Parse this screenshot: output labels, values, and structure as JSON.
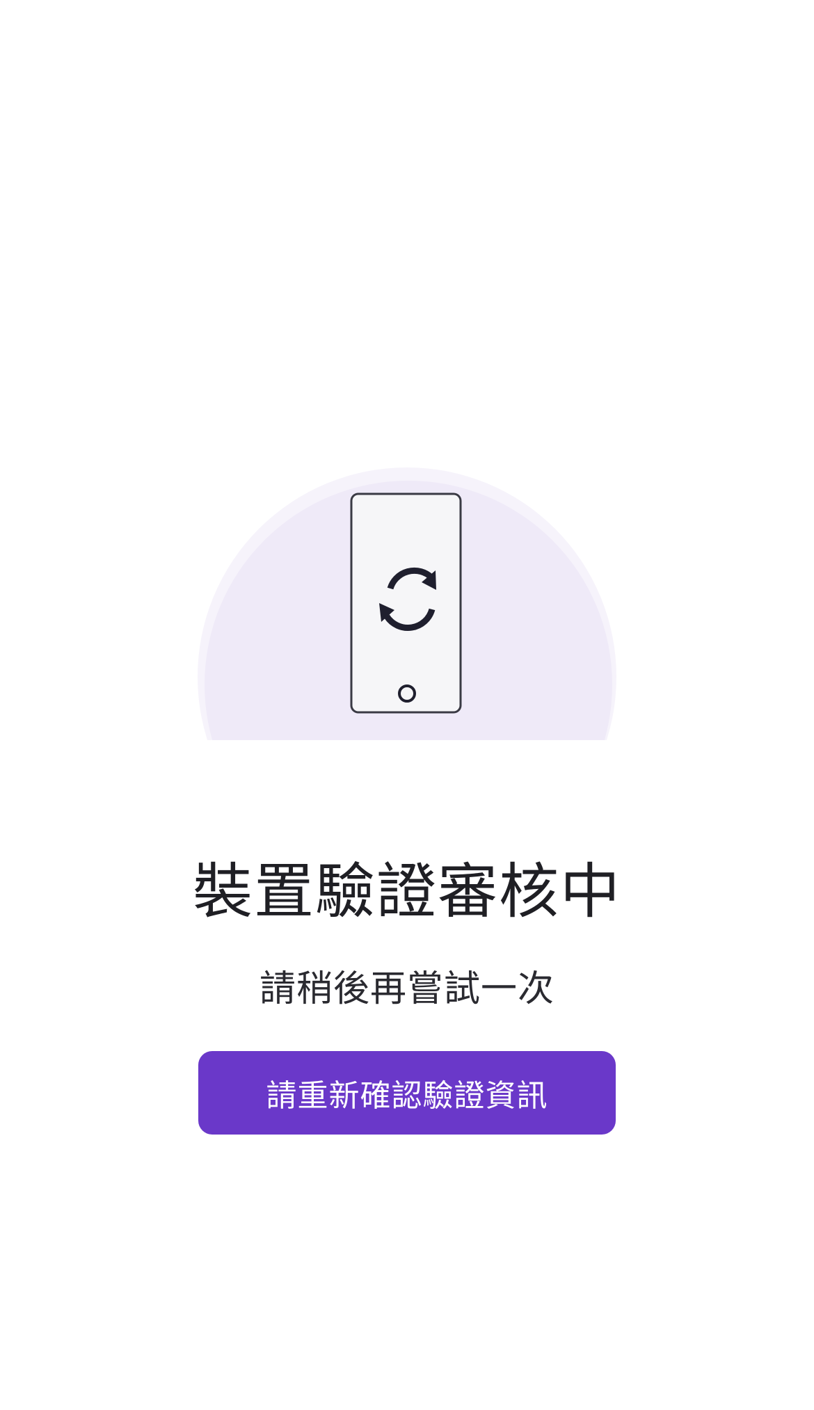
{
  "status": {
    "title": "裝置驗證審核中",
    "subtitle": "請稍後再嘗試一次"
  },
  "actions": {
    "reconfirm_label": "請重新確認驗證資訊"
  },
  "illustration": {
    "device_icon": "phone-icon",
    "sync_icon": "refresh-icon",
    "home_button_icon": "home-button-icon"
  },
  "colors": {
    "accent": "#6a38c9",
    "illustration_circle": "#efeaf8",
    "illustration_circle_outer": "#f6f3fb",
    "device_fill": "#f6f6f8",
    "device_stroke": "#3a3a44",
    "icon_dark": "#1f1f2e"
  }
}
